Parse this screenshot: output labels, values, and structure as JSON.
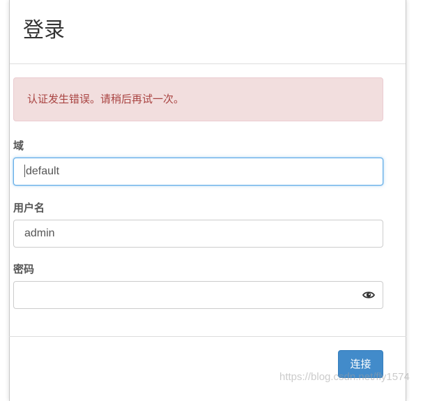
{
  "dialog": {
    "title": "登录",
    "alert_message": "认证发生错误。请稍后再试一次。"
  },
  "form": {
    "domain": {
      "label": "域",
      "value": "default"
    },
    "username": {
      "label": "用户名",
      "value": "admin"
    },
    "password": {
      "label": "密码",
      "value": "",
      "toggle_icon": "eye-icon"
    }
  },
  "footer": {
    "connect_label": "连接"
  },
  "watermark": "https://blog.csdn.net/fly1574",
  "colors": {
    "alert_background": "#f2dede",
    "alert_text": "#a94442",
    "primary_button": "#428bca",
    "focus_border": "#66afe9"
  }
}
